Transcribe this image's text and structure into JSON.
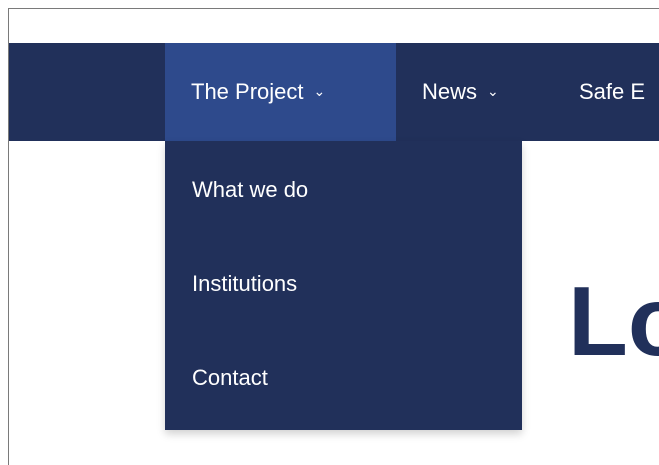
{
  "nav": {
    "items": [
      {
        "label": "The Project",
        "chevron": "⌄"
      },
      {
        "label": "News",
        "chevron": "⌄"
      },
      {
        "label": "Safe E"
      }
    ]
  },
  "dropdown": {
    "items": [
      {
        "label": "What we do"
      },
      {
        "label": "Institutions"
      },
      {
        "label": "Contact"
      }
    ]
  },
  "hero": {
    "heading_fragment": "Lo"
  },
  "colors": {
    "nav_bg": "#21305a",
    "active_bg": "#2e4a8c",
    "text": "#ffffff",
    "heading": "#21305a"
  }
}
